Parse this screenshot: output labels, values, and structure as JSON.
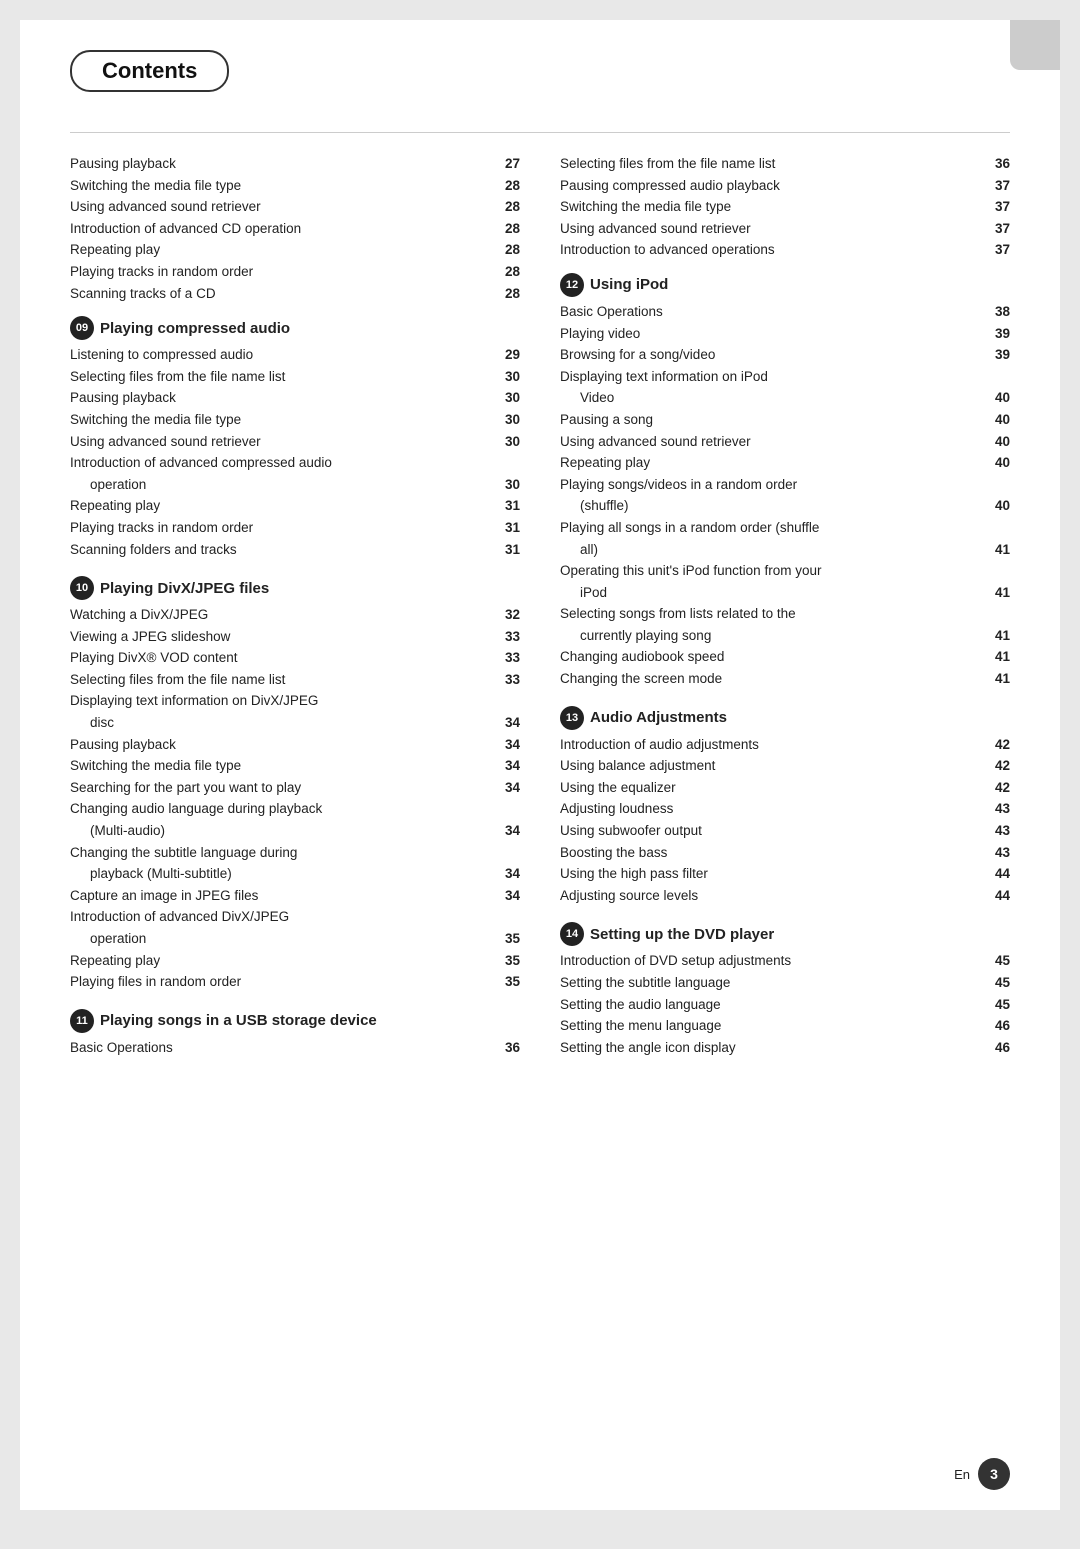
{
  "title": "Contents",
  "top_right_tab": "",
  "left_column": {
    "intro_items": [
      {
        "text": "Pausing playback",
        "num": "27"
      },
      {
        "text": "Switching the media file type",
        "num": "28"
      },
      {
        "text": "Using advanced sound retriever",
        "num": "28"
      },
      {
        "text": "Introduction of advanced CD operation",
        "num": "28"
      },
      {
        "text": "Repeating play",
        "num": "28"
      },
      {
        "text": "Playing tracks in random order",
        "num": "28"
      },
      {
        "text": "Scanning tracks of a CD",
        "num": "28"
      }
    ],
    "sections": [
      {
        "badge": "09",
        "title": "Playing compressed audio",
        "items": [
          {
            "text": "Listening to compressed audio",
            "num": "29",
            "indent": false
          },
          {
            "text": "Selecting files from the file name list",
            "num": "30",
            "indent": false
          },
          {
            "text": "Pausing playback",
            "num": "30",
            "indent": false
          },
          {
            "text": "Switching the media file type",
            "num": "30",
            "indent": false
          },
          {
            "text": "Using advanced sound retriever",
            "num": "30",
            "indent": false
          },
          {
            "text": "Introduction of advanced compressed audio",
            "num": "",
            "indent": false
          },
          {
            "text": "operation",
            "num": "30",
            "indent": true
          },
          {
            "text": "Repeating play",
            "num": "31",
            "indent": false
          },
          {
            "text": "Playing tracks in random order",
            "num": "31",
            "indent": false
          },
          {
            "text": "Scanning folders and tracks",
            "num": "31",
            "indent": false
          }
        ]
      },
      {
        "badge": "10",
        "title": "Playing DivX/JPEG files",
        "items": [
          {
            "text": "Watching a DivX/JPEG",
            "num": "32",
            "indent": false
          },
          {
            "text": "Viewing a JPEG slideshow",
            "num": "33",
            "indent": false
          },
          {
            "text": "Playing DivX® VOD content",
            "num": "33",
            "indent": false
          },
          {
            "text": "Selecting files from the file name list",
            "num": "33",
            "indent": false
          },
          {
            "text": "Displaying text information on DivX/JPEG",
            "num": "",
            "indent": false
          },
          {
            "text": "disc",
            "num": "34",
            "indent": true
          },
          {
            "text": "Pausing playback",
            "num": "34",
            "indent": false
          },
          {
            "text": "Switching the media file type",
            "num": "34",
            "indent": false
          },
          {
            "text": "Searching for the part you want to play",
            "num": "34",
            "indent": false
          },
          {
            "text": "Changing audio language during playback",
            "num": "",
            "indent": false
          },
          {
            "text": "(Multi-audio)",
            "num": "34",
            "indent": true
          },
          {
            "text": "Changing the subtitle language during",
            "num": "",
            "indent": false
          },
          {
            "text": "playback (Multi-subtitle)",
            "num": "34",
            "indent": true
          },
          {
            "text": "Capture an image in JPEG files",
            "num": "34",
            "indent": false
          },
          {
            "text": "Introduction of advanced DivX/JPEG",
            "num": "",
            "indent": false
          },
          {
            "text": "operation",
            "num": "35",
            "indent": true
          },
          {
            "text": "Repeating play",
            "num": "35",
            "indent": false
          },
          {
            "text": "Playing files in random order",
            "num": "35",
            "indent": false
          }
        ]
      },
      {
        "badge": "11",
        "title": "Playing songs in a USB storage device",
        "items": [
          {
            "text": "Basic Operations",
            "num": "36",
            "indent": false
          }
        ]
      }
    ]
  },
  "right_column": {
    "intro_items": [
      {
        "text": "Selecting files from the file name list",
        "num": "36"
      },
      {
        "text": "Pausing compressed audio playback",
        "num": "37"
      },
      {
        "text": "Switching the media file type",
        "num": "37"
      },
      {
        "text": "Using advanced sound retriever",
        "num": "37"
      },
      {
        "text": "Introduction to advanced operations",
        "num": "37"
      }
    ],
    "sections": [
      {
        "badge": "12",
        "title": "Using iPod",
        "items": [
          {
            "text": "Basic Operations",
            "num": "38",
            "indent": false
          },
          {
            "text": "Playing video",
            "num": "39",
            "indent": false
          },
          {
            "text": "Browsing for a song/video",
            "num": "39",
            "indent": false
          },
          {
            "text": "Displaying text information on iPod",
            "num": "",
            "indent": false
          },
          {
            "text": "Video",
            "num": "40",
            "indent": true
          },
          {
            "text": "Pausing a song",
            "num": "40",
            "indent": false
          },
          {
            "text": "Using advanced sound retriever",
            "num": "40",
            "indent": false
          },
          {
            "text": "Repeating play",
            "num": "40",
            "indent": false
          },
          {
            "text": "Playing songs/videos in a random order",
            "num": "",
            "indent": false
          },
          {
            "text": "(shuffle)",
            "num": "40",
            "indent": true
          },
          {
            "text": "Playing all songs in a random order (shuffle",
            "num": "",
            "indent": false
          },
          {
            "text": "all)",
            "num": "41",
            "indent": true
          },
          {
            "text": "Operating this unit's iPod function from your",
            "num": "",
            "indent": false
          },
          {
            "text": "iPod",
            "num": "41",
            "indent": true
          },
          {
            "text": "Selecting songs from lists related to the",
            "num": "",
            "indent": false
          },
          {
            "text": "currently playing song",
            "num": "41",
            "indent": true
          },
          {
            "text": "Changing audiobook speed",
            "num": "41",
            "indent": false
          },
          {
            "text": "Changing the screen mode",
            "num": "41",
            "indent": false
          }
        ]
      },
      {
        "badge": "13",
        "title": "Audio Adjustments",
        "items": [
          {
            "text": "Introduction of audio adjustments",
            "num": "42",
            "indent": false
          },
          {
            "text": "Using balance adjustment",
            "num": "42",
            "indent": false
          },
          {
            "text": "Using the equalizer",
            "num": "42",
            "indent": false
          },
          {
            "text": "Adjusting loudness",
            "num": "43",
            "indent": false
          },
          {
            "text": "Using subwoofer output",
            "num": "43",
            "indent": false
          },
          {
            "text": "Boosting the bass",
            "num": "43",
            "indent": false
          },
          {
            "text": "Using the high pass filter",
            "num": "44",
            "indent": false
          },
          {
            "text": "Adjusting source levels",
            "num": "44",
            "indent": false
          }
        ]
      },
      {
        "badge": "14",
        "title": "Setting up the DVD player",
        "items": [
          {
            "text": "Introduction of DVD setup adjustments",
            "num": "45",
            "indent": false
          },
          {
            "text": "Setting the subtitle language",
            "num": "45",
            "indent": false
          },
          {
            "text": "Setting the audio language",
            "num": "45",
            "indent": false
          },
          {
            "text": "Setting the menu language",
            "num": "46",
            "indent": false
          },
          {
            "text": "Setting the angle icon display",
            "num": "46",
            "indent": false
          }
        ]
      }
    ]
  },
  "footer": {
    "lang": "En",
    "page": "3"
  }
}
